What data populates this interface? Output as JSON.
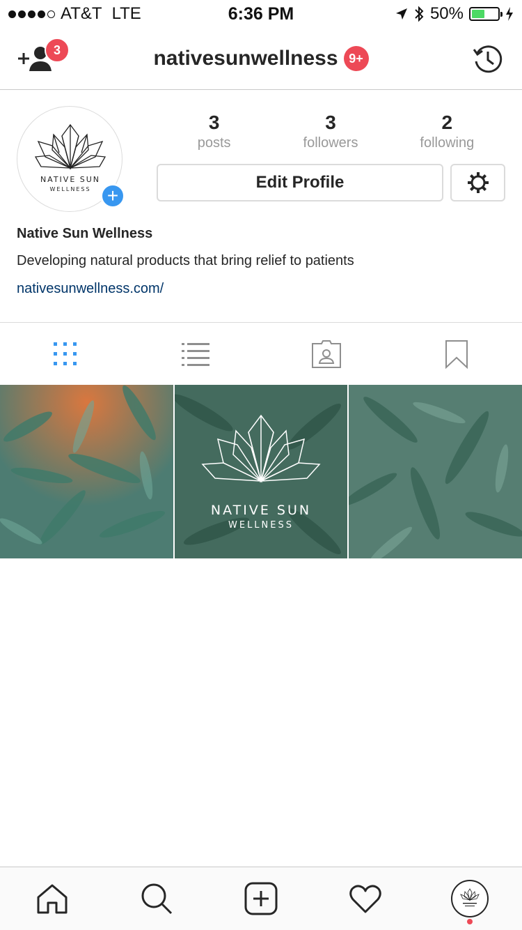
{
  "status_bar": {
    "carrier": "AT&T",
    "network": "LTE",
    "time": "6:36 PM",
    "battery_percent": "50%",
    "battery_level": 0.5,
    "signal_bars": 4,
    "signal_total": 5
  },
  "nav": {
    "username": "nativesunwellness",
    "title_badge": "9+",
    "add_people_badge": "3",
    "icons": [
      "add-person-icon",
      "history-icon"
    ]
  },
  "profile": {
    "stats": [
      {
        "value": "3",
        "label": "posts"
      },
      {
        "value": "3",
        "label": "followers"
      },
      {
        "value": "2",
        "label": "following"
      }
    ],
    "edit_label": "Edit Profile",
    "name": "Native Sun Wellness",
    "bio": "Developing natural products that bring relief to patients",
    "link": "nativesunwellness.com/",
    "logo_text_main": "NATIVE SUN",
    "logo_text_sub": "WELLNESS"
  },
  "tabs": [
    {
      "name": "grid-icon",
      "active": true
    },
    {
      "name": "list-icon",
      "active": false
    },
    {
      "name": "tagged-icon",
      "active": false
    },
    {
      "name": "saved-icon",
      "active": false
    }
  ],
  "grid": {
    "post2_main": "NATIVE SUN",
    "post2_sub": "WELLNESS"
  },
  "tabbar": [
    "home-icon",
    "search-icon",
    "new-post-icon",
    "activity-icon",
    "profile-icon"
  ],
  "colors": {
    "accent_blue": "#3897f0",
    "badge_red": "#ed4956",
    "link_blue": "#003569",
    "battery_green": "#4cd964"
  }
}
